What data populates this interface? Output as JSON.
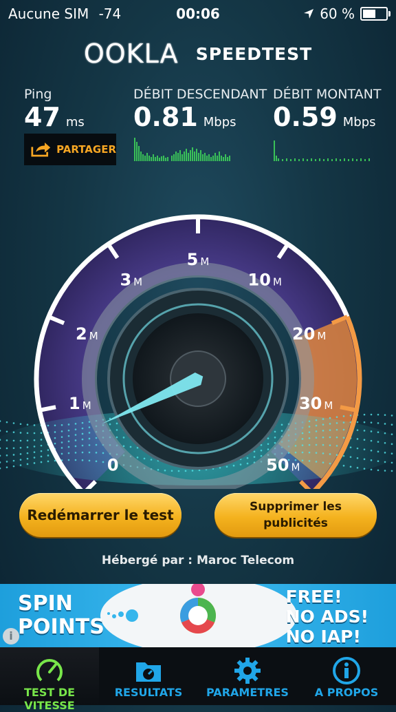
{
  "status_bar": {
    "carrier": "Aucune SIM",
    "signal": "-74",
    "time": "00:06",
    "battery_percent": "60 %",
    "battery_level": 0.6
  },
  "header": {
    "logo": "OOKLA",
    "title": "SPEEDTEST"
  },
  "stats": {
    "ping": {
      "label": "Ping",
      "value": "47",
      "unit": "ms"
    },
    "download": {
      "label": "DÉBIT DESCENDANT",
      "value": "0.81",
      "unit": "Mbps"
    },
    "upload": {
      "label": "DÉBIT MONTANT",
      "value": "0.59",
      "unit": "Mbps"
    },
    "share_label": "PARTAGER"
  },
  "gauge": {
    "ticks": [
      {
        "num": "0",
        "suffix": ""
      },
      {
        "num": "1",
        "suffix": "M"
      },
      {
        "num": "2",
        "suffix": "M"
      },
      {
        "num": "3",
        "suffix": "M"
      },
      {
        "num": "5",
        "suffix": "M"
      },
      {
        "num": "10",
        "suffix": "M"
      },
      {
        "num": "20",
        "suffix": "M"
      },
      {
        "num": "30",
        "suffix": "M"
      },
      {
        "num": "50",
        "suffix": "M"
      }
    ],
    "needle_value_mbps": 0.59
  },
  "buttons": {
    "restart": "Redémarrer le test",
    "remove_ads": "Supprimer les publicités"
  },
  "hosted_by": "Hébergé par : Maroc Telecom",
  "ad": {
    "left_line1": "SPIN",
    "left_line2": "POINTS",
    "right_line1": "FREE!",
    "right_line2": "NO ADS!",
    "right_line3": "NO IAP!"
  },
  "tabs": [
    {
      "label": "TEST DE VITESSE",
      "icon": "speedometer-icon",
      "active": true
    },
    {
      "label": "RESULTATS",
      "icon": "folder-icon",
      "active": false
    },
    {
      "label": "PARAMETRES",
      "icon": "gear-icon",
      "active": false
    },
    {
      "label": "A PROPOS",
      "icon": "info-icon",
      "active": false
    }
  ],
  "colors": {
    "accent_orange": "#f6a623",
    "tab_blue": "#20a6e8",
    "tab_active_green": "#78e64a",
    "ad_blue": "#37b5ec",
    "spark_green": "#3ed05a"
  }
}
